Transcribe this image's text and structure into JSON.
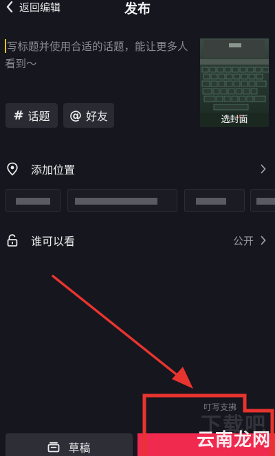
{
  "header": {
    "back_label": "返回编辑",
    "title": "发布"
  },
  "caption": {
    "placeholder": "写标题并使用合适的话题，能让更多人看到～"
  },
  "cover": {
    "label": "选封面",
    "icon": "laptop-keyboard-thumbnail"
  },
  "chips": [
    {
      "symbol": "#",
      "label": "话题",
      "icon": "hashtag-icon"
    },
    {
      "symbol": "@",
      "label": "好友",
      "icon": "at-icon"
    }
  ],
  "location": {
    "label": "添加位置",
    "icon": "location-pin-icon",
    "suggestions_count": 5
  },
  "privacy": {
    "label": "谁可以看",
    "value": "公开",
    "icon": "lock-icon"
  },
  "actions": {
    "draft_label": "草稿",
    "publish_label": ""
  },
  "watermark": {
    "text": "云南龙网",
    "faint_text": "叮写支拂",
    "big_text": "下载吧"
  },
  "colors": {
    "background": "#16161e",
    "chip_bg": "#2a2a33",
    "publish": "#f0294e",
    "annotation": "#e8342f",
    "caret": "#f5c518"
  }
}
